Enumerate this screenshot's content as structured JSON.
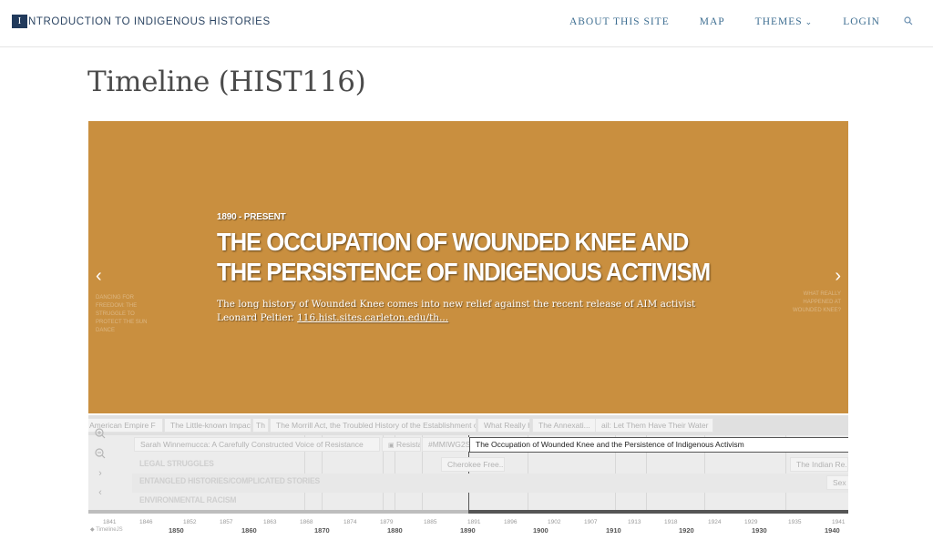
{
  "site": {
    "brand_letter": "I",
    "brand_rest": "NTRODUCTION TO INDIGENOUS HISTORIES",
    "nav": [
      {
        "label": "ABOUT THIS SITE"
      },
      {
        "label": "MAP"
      },
      {
        "label": "THEMES"
      },
      {
        "label": "LOGIN"
      }
    ]
  },
  "page": {
    "title": "Timeline (HIST116)"
  },
  "slide": {
    "date": "1890 - PRESENT",
    "headline": "THE OCCUPATION OF WOUNDED KNEE AND THE PERSISTENCE OF INDIGENOUS ACTIVISM",
    "text": "The long history of Wounded Knee comes into new relief against the recent release of AIM activist Leonard Peltier.",
    "link": "116.hist.sites.carleton.edu/th...",
    "prev_title": "DANCING FOR FREEDOM: THE STRUGGLE TO PROTECT THE SUN DANCE",
    "next_title": "WHAT REALLY HAPPENED AT WOUNDED KNEE?",
    "color": "#c98f3f"
  },
  "timenav": {
    "top_markers": [
      "American Empire F",
      "The Little-known Impact",
      "Th",
      "The Morrill Act, the Troubled History of the Establishment of L",
      "What Really H",
      "The Annexati...",
      "ail: Let Them Have Their Water"
    ],
    "row2_markers": [
      "Sarah Winnemucca: A Carefully Constructed Voice of Resistance",
      "Resista",
      "#MMIWG2S A"
    ],
    "active_marker": "The Occupation of Wounded Knee and the Persistence of Indigenous Activism",
    "groups": [
      {
        "label": "LEGAL STRUGGLES",
        "markers": [
          "Cherokee Free...",
          "The Indian Re..."
        ]
      },
      {
        "label": "ENTANGLED HISTORIES/COMPLICATED STORIES",
        "markers": [
          "Sex"
        ]
      },
      {
        "label": "ENVIRONMENTAL RACISM",
        "markers": []
      }
    ],
    "minor_ticks": [
      "1841",
      "1846",
      "1852",
      "1857",
      "1863",
      "1868",
      "1874",
      "1879",
      "1885",
      "1891",
      "1896",
      "1902",
      "1907",
      "1913",
      "1918",
      "1924",
      "1929",
      "1935",
      "1941"
    ],
    "major_ticks": [
      "1850",
      "1860",
      "1870",
      "1880",
      "1890",
      "1900",
      "1910",
      "1920",
      "1930",
      "1940"
    ],
    "attribution": "TimelineJS"
  }
}
